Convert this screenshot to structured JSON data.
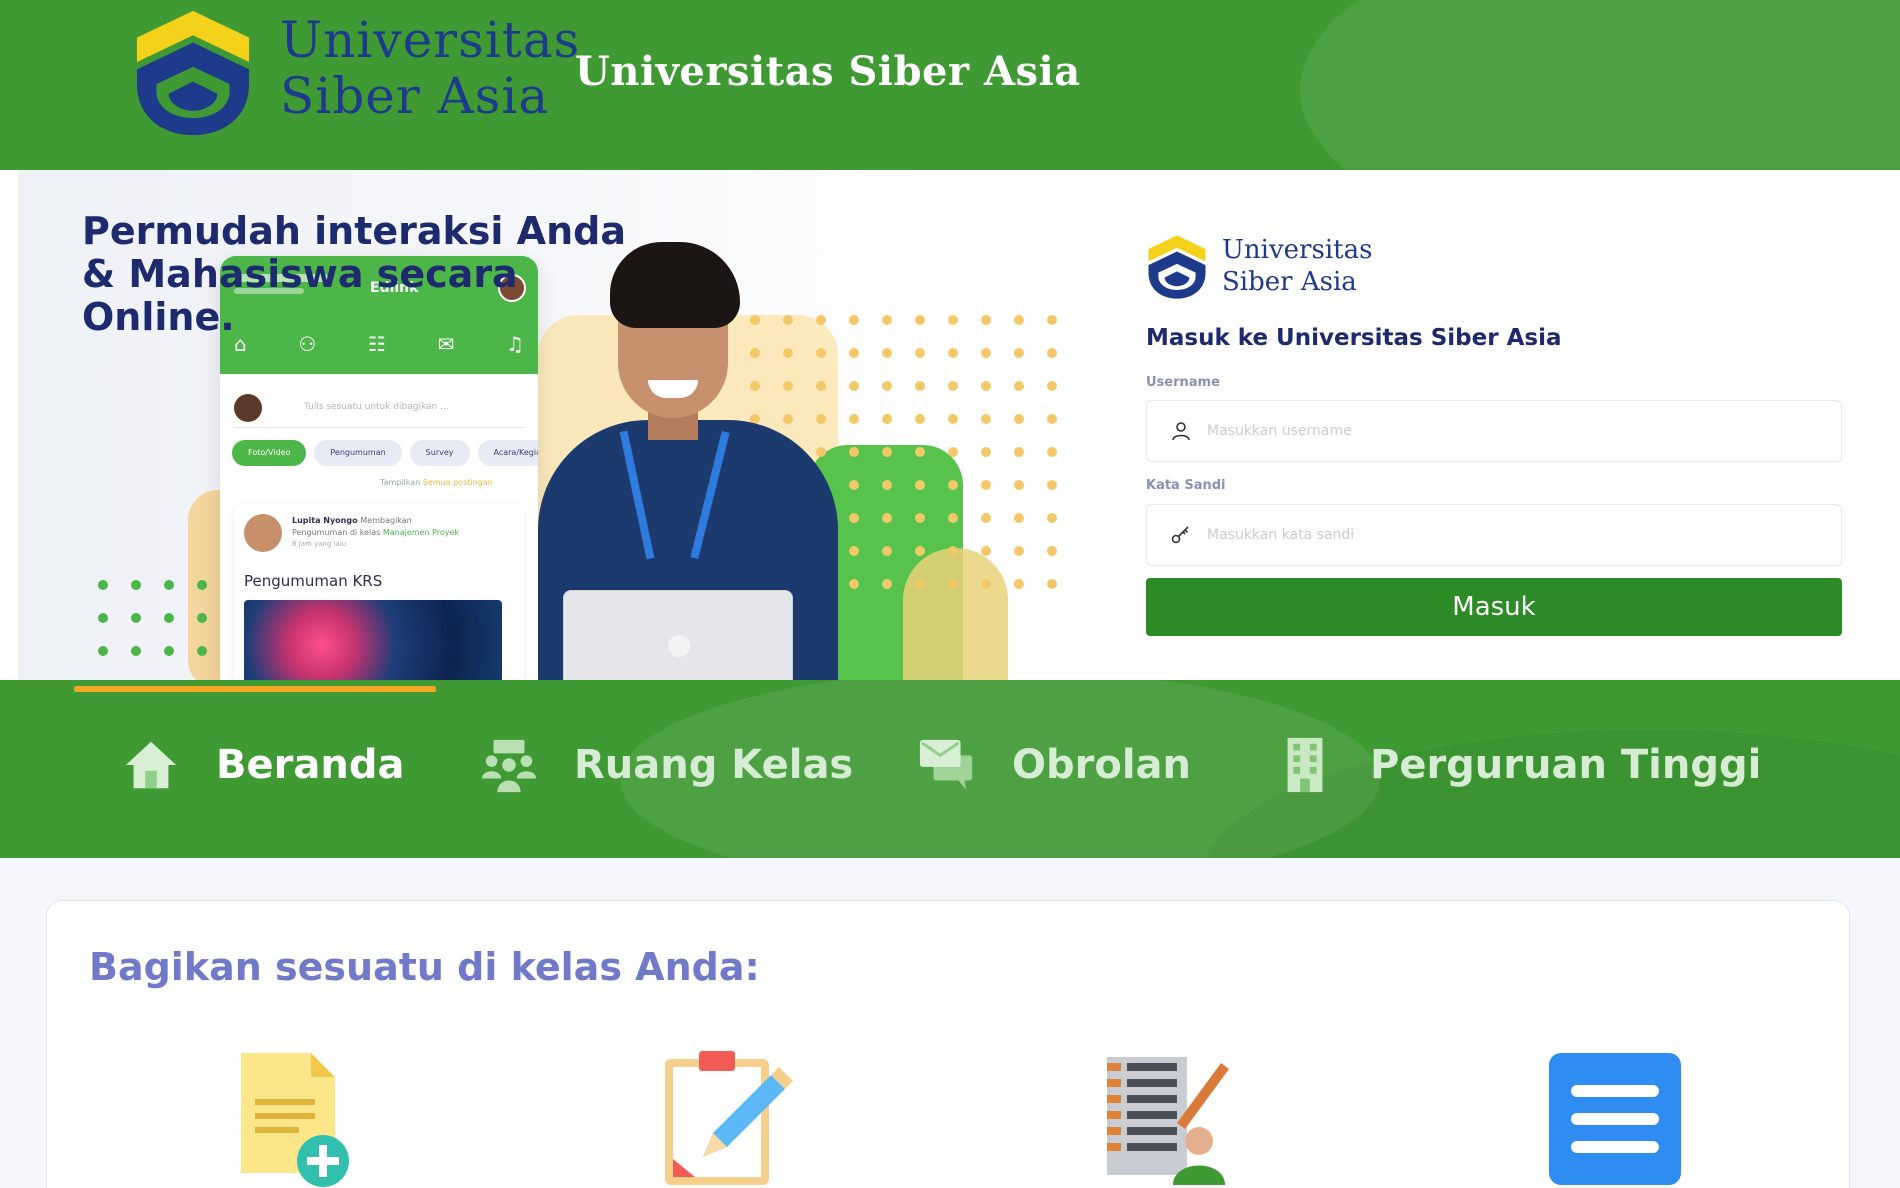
{
  "header": {
    "logo_line1": "Universitas",
    "logo_line2": "Siber Asia",
    "title": "Universitas Siber Asia"
  },
  "hero": {
    "headline": "Permudah interaksi Anda & Mahasiswa secara Online.",
    "phone": {
      "app_name": "Edlink",
      "post_placeholder": "Tulis sesuatu untuk dibagikan ...",
      "chips": [
        "Foto/Video",
        "Pengumuman",
        "Survey",
        "Acara/Kegiatan"
      ],
      "show_link_prefix": "Tampilkan",
      "show_link_highlight": "Semua postingan",
      "card_author": "Lupita Nyongo",
      "card_action": "Membagikan",
      "card_subject": "Pengumuman di kelas",
      "card_course": "Manajemen Proyek",
      "card_time": "8 Jam yang lalu",
      "card_heading": "Pengumuman KRS"
    }
  },
  "login": {
    "logo_line1": "Universitas",
    "logo_line2": "Siber Asia",
    "title": "Masuk ke Universitas Siber Asia",
    "username_label": "Username",
    "username_placeholder": "Masukkan username",
    "password_label": "Kata Sandi",
    "password_placeholder": "Masukkan kata sandi",
    "submit_label": "Masuk"
  },
  "nav": {
    "items": [
      {
        "label": "Beranda",
        "icon": "home-icon",
        "active": true
      },
      {
        "label": "Ruang Kelas",
        "icon": "classroom-icon",
        "active": false
      },
      {
        "label": "Obrolan",
        "icon": "chat-icon",
        "active": false
      },
      {
        "label": "Perguruan Tinggi",
        "icon": "building-icon",
        "active": false
      }
    ]
  },
  "share": {
    "title": "Bagikan sesuatu di kelas Anda:",
    "icons": [
      "add-document-icon",
      "clipboard-edit-icon",
      "assignment-grader-icon",
      "list-menu-icon"
    ]
  },
  "colors": {
    "brand_green": "#3f9a33",
    "button_green": "#2c8a27",
    "navy": "#1e2a6e",
    "logo_yellow": "#f4d21c",
    "logo_blue": "#1e3a8a",
    "accent_orange": "#f5a623",
    "share_title": "#7179c9"
  }
}
